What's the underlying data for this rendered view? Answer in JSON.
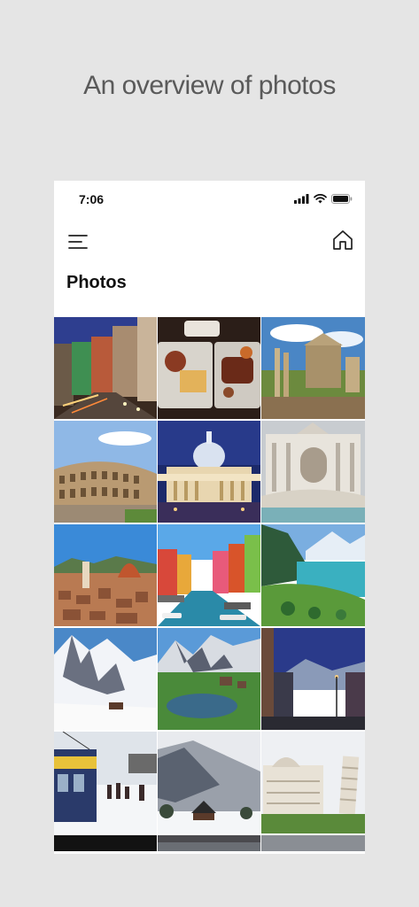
{
  "headline": "An overview of photos",
  "status_bar": {
    "time": "7:06",
    "icons": [
      "signal-icon",
      "wifi-icon",
      "battery-icon"
    ]
  },
  "nav": {
    "menu_icon": "hamburger-menu-icon",
    "home_icon": "home-icon"
  },
  "page_title": "Photos",
  "photos": [
    {
      "subject": "city-street-night"
    },
    {
      "subject": "food-platters"
    },
    {
      "subject": "roman-forum"
    },
    {
      "subject": "colosseum"
    },
    {
      "subject": "st-peters-basilica-night"
    },
    {
      "subject": "trevi-fountain"
    },
    {
      "subject": "florence-cathedral"
    },
    {
      "subject": "venice-canal"
    },
    {
      "subject": "alpine-lake"
    },
    {
      "subject": "snowy-mountain"
    },
    {
      "subject": "mountain-lake-reflection"
    },
    {
      "subject": "town-street-dusk"
    },
    {
      "subject": "snow-train"
    },
    {
      "subject": "snowy-village"
    },
    {
      "subject": "pisa-cathedral-tower"
    }
  ],
  "colors": {
    "background": "#e5e5e5",
    "headline": "#5a5a5a",
    "screen": "#ffffff",
    "text": "#111111"
  }
}
